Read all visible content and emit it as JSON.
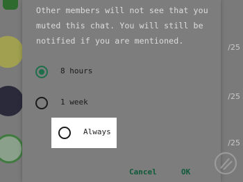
{
  "dialog": {
    "message": "Other members will not see that you muted this chat. You will still be notified if you are mentioned.",
    "options": [
      {
        "label": "8 hours",
        "selected": true
      },
      {
        "label": "1 week",
        "selected": false
      },
      {
        "label": "Always",
        "selected": false
      }
    ],
    "cancel_label": "Cancel",
    "ok_label": "OK"
  },
  "background": {
    "times": [
      "/25",
      "/25",
      "/25"
    ]
  },
  "colors": {
    "accent": "#1f6e4a",
    "button_text": "#0f5a3a",
    "overlay": "#7a7a7a"
  },
  "icons": {
    "watermark": "gadgets-logo-icon"
  }
}
